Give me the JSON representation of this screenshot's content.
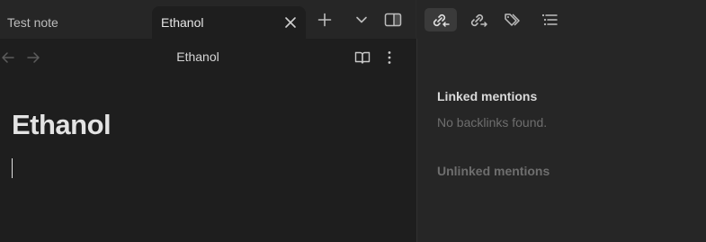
{
  "tabs": [
    {
      "label": "Test note",
      "active": false
    },
    {
      "label": "Ethanol",
      "active": true
    }
  ],
  "toolbar": {
    "icons": [
      "new-tab-icon",
      "tab-list-chevron-icon",
      "toggle-sidebar-icon",
      "backlinks-icon",
      "outgoing-links-icon",
      "tags-icon",
      "outline-icon"
    ],
    "active_icon": "backlinks-icon"
  },
  "editor": {
    "view_title": "Ethanol",
    "note_title": "Ethanol",
    "icons": [
      "back-arrow-icon",
      "forward-arrow-icon",
      "reading-view-icon",
      "more-options-icon"
    ]
  },
  "backlinks": {
    "linked_heading": "Linked mentions",
    "linked_empty": "No backlinks found.",
    "unlinked_heading": "Unlinked mentions"
  },
  "colors": {
    "background": "#1e1e1e",
    "tabbar": "#262626",
    "sidebar": "#262626",
    "text": "#e3e3e3",
    "muted": "#6e6e6e"
  }
}
